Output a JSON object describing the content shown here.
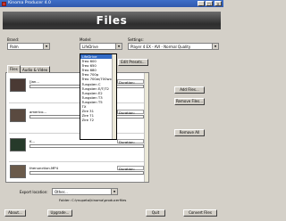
{
  "window": {
    "title": "Kinoma Producer 4.0",
    "minimize": "_",
    "maximize": "□",
    "close": "×"
  },
  "banner": {
    "text": "Files"
  },
  "brand": {
    "label": "Brand:",
    "value": "Palm"
  },
  "model": {
    "label": "Model:",
    "value": "LifeDrive",
    "options": [
      "LifeDrive",
      "Treo 600",
      "Treo 650",
      "Treo 680",
      "Treo 700p",
      "Treo 700w/700wx",
      "Tungsten C",
      "Tungsten E/T/T2",
      "Tungsten E2",
      "Tungsten T3",
      "Tungsten T5",
      "TX",
      "Zire 31",
      "Zire 71",
      "Zire 72"
    ]
  },
  "settings": {
    "label": "Settings:",
    "value": "Player 4 EX - AVI - Normal Quality",
    "edit_presets": "Edit Presets..."
  },
  "tabs": {
    "files": "Files",
    "audio_video": "Audio & Video"
  },
  "files": [
    {
      "name": "[Jan...",
      "duration": "Duration: 01:44:03",
      "progress": 0,
      "thumb_color": "#4a3a34"
    },
    {
      "name": "americo...",
      "duration": "Duration: 01:57:52",
      "progress": 0,
      "thumb_color": "#5a4a40"
    },
    {
      "name": "K...",
      "duration": "Duration: 01:52:04",
      "progress": 0,
      "thumb_color": "#263a2a"
    },
    {
      "name": "thenunction.MP4",
      "duration": "Duration: 01:58:56",
      "progress": 0,
      "thumb_color": "#6a5a4a"
    }
  ],
  "side_buttons": {
    "add_files": "Add Files...",
    "remove_files": "Remove Files...",
    "remove_all": "Remove All"
  },
  "export": {
    "label": "Export location:",
    "value": "Other...",
    "folder_label": "Folder:",
    "folder_value": "C:\\mupeta\\kinoma\\producerfiles"
  },
  "bottom_buttons": {
    "about": "About...",
    "upgrade": "Upgrade...",
    "quit": "Quit",
    "convert": "Convert Files"
  },
  "colors": {
    "banner": "#3a3a3a",
    "selection": "#316ac5",
    "titlebar": "#2f59ad"
  }
}
